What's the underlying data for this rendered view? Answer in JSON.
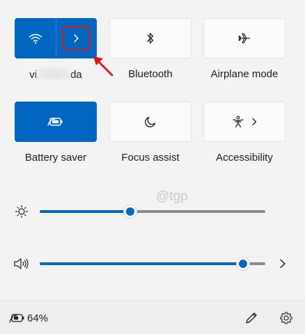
{
  "tiles": {
    "wifi": {
      "label_visible": "vi",
      "label_visible_end": "da",
      "icon": "wifi-icon",
      "chevron_icon": "chevron-right-icon",
      "active": true
    },
    "bluetooth": {
      "label": "Bluetooth",
      "icon": "bluetooth-icon",
      "active": false
    },
    "airplane": {
      "label": "Airplane mode",
      "icon": "airplane-icon",
      "active": false
    },
    "battery_saver": {
      "label": "Battery saver",
      "icon": "battery-saver-icon",
      "active": true
    },
    "focus_assist": {
      "label": "Focus assist",
      "icon": "moon-icon",
      "active": false
    },
    "accessibility": {
      "label": "Accessibility",
      "icon": "accessibility-icon",
      "chevron_icon": "chevron-right-icon",
      "active": false
    }
  },
  "watermark": "@tgp",
  "brightness": {
    "icon": "brightness-icon",
    "level_percent": 40
  },
  "volume": {
    "icon": "volume-icon",
    "level_percent": 90,
    "chevron_icon": "chevron-right-icon"
  },
  "footer": {
    "battery_icon": "battery-charging-icon",
    "battery_percent": "64%",
    "edit_icon": "pencil-icon",
    "settings_icon": "gear-icon"
  },
  "annotation": {
    "arrow_color": "#e0141e",
    "box_color": "#e0141e"
  },
  "colors": {
    "accent": "#0067c0",
    "background": "#f3f3f3"
  }
}
